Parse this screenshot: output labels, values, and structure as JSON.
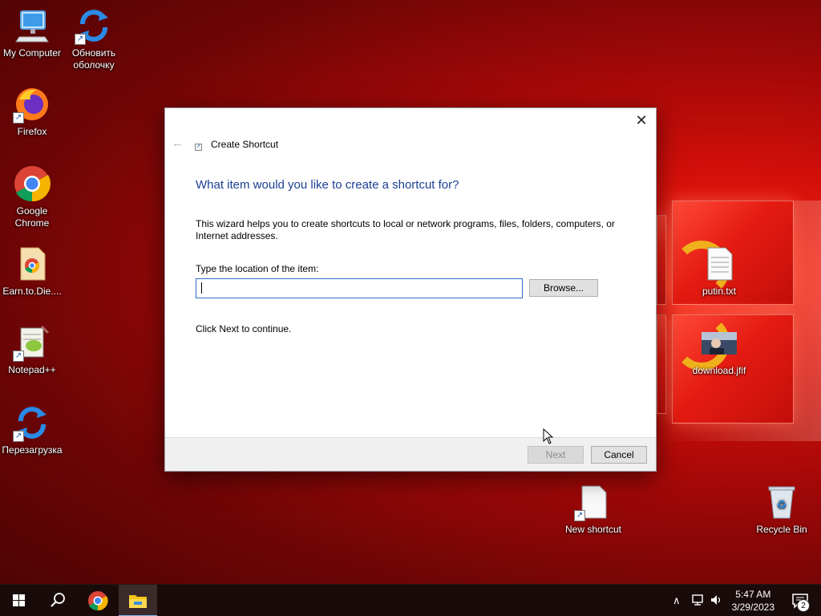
{
  "desktop": {
    "icons_left": [
      {
        "label": "My Computer",
        "icon": "computer-icon"
      },
      {
        "label": "Обновить оболочку",
        "icon": "refresh-icon",
        "shortcut": true
      },
      {
        "label": "Firefox",
        "icon": "firefox-icon",
        "shortcut": true
      },
      {
        "label": "Google Chrome",
        "icon": "chrome-icon",
        "shortcut": true
      },
      {
        "label": "Earn.to.Die....",
        "icon": "document-chrome-icon"
      },
      {
        "label": "Notepad++",
        "icon": "notepadpp-icon",
        "shortcut": true
      },
      {
        "label": "Перезагрузка",
        "icon": "refresh-icon",
        "shortcut": true
      }
    ],
    "icons_right": [
      {
        "label": "putin.txt",
        "icon": "text-file-icon"
      },
      {
        "label": "download.jfif",
        "icon": "image-file-icon"
      },
      {
        "label": "New shortcut",
        "icon": "blank-file-icon",
        "shortcut": true
      },
      {
        "label": "Recycle Bin",
        "icon": "recycle-bin-icon"
      }
    ]
  },
  "dialog": {
    "title": "Create Shortcut",
    "heading": "What item would you like to create a shortcut for?",
    "description": "This wizard helps you to create shortcuts to local or network programs, files, folders, computers, or Internet addresses.",
    "location_label": "Type the location of the item:",
    "location_value": "",
    "browse_label": "Browse...",
    "continue_text": "Click Next to continue.",
    "next_label": "Next",
    "cancel_label": "Cancel",
    "close_glyph": "✕",
    "back_glyph": "←"
  },
  "taskbar": {
    "time": "5:47 AM",
    "date": "3/29/2023",
    "notification_count": "2",
    "pinned": [
      "start-button",
      "search-button",
      "chrome-button",
      "file-explorer-button"
    ]
  },
  "colors": {
    "heading": "#1c3f94",
    "input_border": "#2f6fc4",
    "taskbar": "#1a0b0b"
  }
}
